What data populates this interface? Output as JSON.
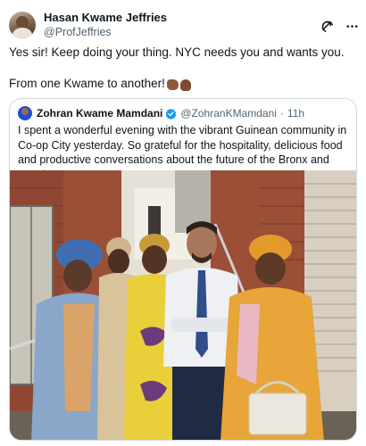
{
  "author": {
    "display_name": "Hasan Kwame Jeffries",
    "handle": "@ProfJeffries"
  },
  "tweet": {
    "line1": "Yes sir! Keep doing your thing. NYC needs you and wants you.",
    "line2": "From one Kwame to another!"
  },
  "quoted": {
    "display_name": "Zohran Kwame Mamdani",
    "handle": "@ZohranKMamdani",
    "separator": "·",
    "time": "11h",
    "text": "I spent a wonderful evening with the vibrant Guinean community in Co-op City yesterday. So grateful for the hospitality, delicious food and productive conversations about the future of the Bronx and our city."
  },
  "icons": {
    "header_left": "grok-icon",
    "header_right": "more-icon",
    "verified": "verified-badge-icon",
    "emoji": [
      "fist-bump-emoji",
      "raised-fist-emoji"
    ]
  },
  "colors": {
    "text": "#0f1419",
    "secondary": "#536471",
    "verified": "#1d9bf0",
    "border": "#cfd9de"
  }
}
